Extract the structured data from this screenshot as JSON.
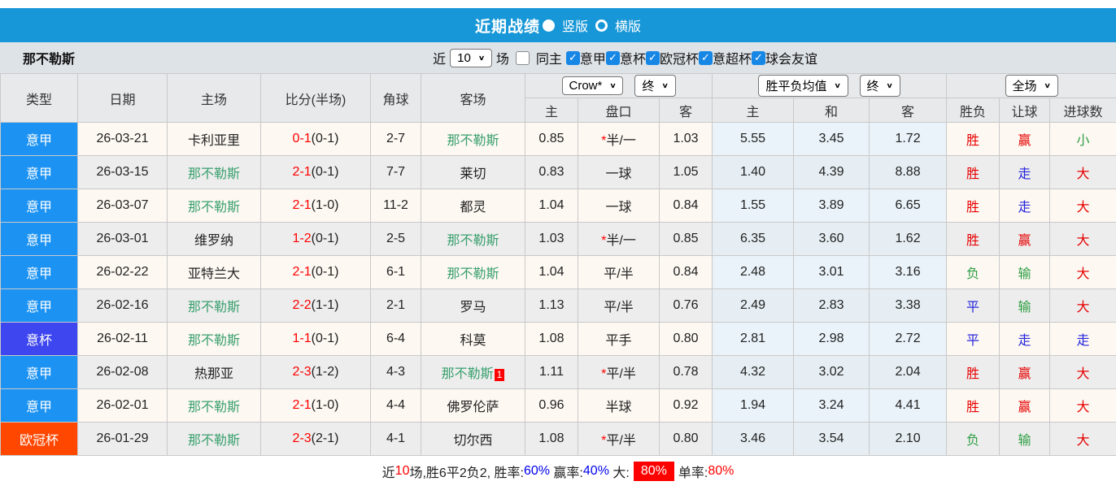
{
  "colors": {
    "accent": "#1797D7",
    "seriea": "#1C93F3",
    "coppa": "#3D46EF",
    "ucl": "#FF4700",
    "team_green": "#3AA06E",
    "red": "#E60000",
    "blue": "#2525DB",
    "green": "#2F9E44",
    "score_red": "#FF0000",
    "cb_blue": "#1787E6",
    "link_blue": "#0000EE"
  },
  "titlebar": {
    "title": "近期战绩",
    "vertical_label": "竖版",
    "horizontal_label": "横版"
  },
  "filterbar": {
    "team": "那不勒斯",
    "recent_label": "近",
    "recent_value": "10",
    "matches_label": "场",
    "same_home_label": "同主",
    "competitions": [
      "意甲",
      "意杯",
      "欧冠杯",
      "意超杯",
      "球会友谊"
    ]
  },
  "table": {
    "dropdowns": {
      "company": "Crow*",
      "company_time": "终",
      "avg": "胜平负均值",
      "avg_time": "终",
      "scope": "全场"
    },
    "headers": {
      "type": "类型",
      "date": "日期",
      "home": "主场",
      "score": "比分(半场)",
      "corners": "角球",
      "away": "客场",
      "odds_home": "主",
      "handicap": "盘口",
      "odds_away": "客",
      "avg_home": "主",
      "avg_draw": "和",
      "avg_away": "客",
      "result": "胜负",
      "let_result": "让球",
      "goal_result": "进球数"
    },
    "rows": [
      {
        "type": "意甲",
        "type_class": "seriea",
        "date": "26-03-21",
        "home": "卡利亚里",
        "home_green": false,
        "score": "0-1",
        "half": "(0-1)",
        "corners": "2-7",
        "away": "那不勒斯",
        "away_green": true,
        "away_note": "",
        "odds_home": "0.85",
        "handicap_star": true,
        "handicap": "半/一",
        "odds_away": "1.03",
        "avg_home": "5.55",
        "avg_draw": "3.45",
        "avg_away": "1.72",
        "result": "胜",
        "result_color": "red",
        "let_result": "赢",
        "let_color": "red",
        "goal_result": "小",
        "goal_color": "green"
      },
      {
        "type": "意甲",
        "type_class": "seriea",
        "date": "26-03-15",
        "home": "那不勒斯",
        "home_green": true,
        "score": "2-1",
        "half": "(0-1)",
        "corners": "7-7",
        "away": "莱切",
        "away_green": false,
        "away_note": "",
        "odds_home": "0.83",
        "handicap_star": false,
        "handicap": "一球",
        "odds_away": "1.05",
        "avg_home": "1.40",
        "avg_draw": "4.39",
        "avg_away": "8.88",
        "result": "胜",
        "result_color": "red",
        "let_result": "走",
        "let_color": "blue",
        "goal_result": "大",
        "goal_color": "red"
      },
      {
        "type": "意甲",
        "type_class": "seriea",
        "date": "26-03-07",
        "home": "那不勒斯",
        "home_green": true,
        "score": "2-1",
        "half": "(1-0)",
        "corners": "11-2",
        "away": "都灵",
        "away_green": false,
        "away_note": "",
        "odds_home": "1.04",
        "handicap_star": false,
        "handicap": "一球",
        "odds_away": "0.84",
        "avg_home": "1.55",
        "avg_draw": "3.89",
        "avg_away": "6.65",
        "result": "胜",
        "result_color": "red",
        "let_result": "走",
        "let_color": "blue",
        "goal_result": "大",
        "goal_color": "red"
      },
      {
        "type": "意甲",
        "type_class": "seriea",
        "date": "26-03-01",
        "home": "维罗纳",
        "home_green": false,
        "score": "1-2",
        "half": "(0-1)",
        "corners": "2-5",
        "away": "那不勒斯",
        "away_green": true,
        "away_note": "",
        "odds_home": "1.03",
        "handicap_star": true,
        "handicap": "半/一",
        "odds_away": "0.85",
        "avg_home": "6.35",
        "avg_draw": "3.60",
        "avg_away": "1.62",
        "result": "胜",
        "result_color": "red",
        "let_result": "赢",
        "let_color": "red",
        "goal_result": "大",
        "goal_color": "red"
      },
      {
        "type": "意甲",
        "type_class": "seriea",
        "date": "26-02-22",
        "home": "亚特兰大",
        "home_green": false,
        "score": "2-1",
        "half": "(0-1)",
        "corners": "6-1",
        "away": "那不勒斯",
        "away_green": true,
        "away_note": "",
        "odds_home": "1.04",
        "handicap_star": false,
        "handicap": "平/半",
        "odds_away": "0.84",
        "avg_home": "2.48",
        "avg_draw": "3.01",
        "avg_away": "3.16",
        "result": "负",
        "result_color": "green",
        "let_result": "输",
        "let_color": "green",
        "goal_result": "大",
        "goal_color": "red"
      },
      {
        "type": "意甲",
        "type_class": "seriea",
        "date": "26-02-16",
        "home": "那不勒斯",
        "home_green": true,
        "score": "2-2",
        "half": "(1-1)",
        "corners": "2-1",
        "away": "罗马",
        "away_green": false,
        "away_note": "",
        "odds_home": "1.13",
        "handicap_star": false,
        "handicap": "平/半",
        "odds_away": "0.76",
        "avg_home": "2.49",
        "avg_draw": "2.83",
        "avg_away": "3.38",
        "result": "平",
        "result_color": "blue",
        "let_result": "输",
        "let_color": "green",
        "goal_result": "大",
        "goal_color": "red"
      },
      {
        "type": "意杯",
        "type_class": "coppa",
        "date": "26-02-11",
        "home": "那不勒斯",
        "home_green": true,
        "score": "1-1",
        "half": "(0-1)",
        "corners": "6-4",
        "away": "科莫",
        "away_green": false,
        "away_note": "",
        "odds_home": "1.08",
        "handicap_star": false,
        "handicap": "平手",
        "odds_away": "0.80",
        "avg_home": "2.81",
        "avg_draw": "2.98",
        "avg_away": "2.72",
        "result": "平",
        "result_color": "blue",
        "let_result": "走",
        "let_color": "blue",
        "goal_result": "走",
        "goal_color": "blue"
      },
      {
        "type": "意甲",
        "type_class": "seriea",
        "date": "26-02-08",
        "home": "热那亚",
        "home_green": false,
        "score": "2-3",
        "half": "(1-2)",
        "corners": "4-3",
        "away": "那不勒斯",
        "away_green": true,
        "away_note": "1",
        "odds_home": "1.11",
        "handicap_star": true,
        "handicap": "平/半",
        "odds_away": "0.78",
        "avg_home": "4.32",
        "avg_draw": "3.02",
        "avg_away": "2.04",
        "result": "胜",
        "result_color": "red",
        "let_result": "赢",
        "let_color": "red",
        "goal_result": "大",
        "goal_color": "red"
      },
      {
        "type": "意甲",
        "type_class": "seriea",
        "date": "26-02-01",
        "home": "那不勒斯",
        "home_green": true,
        "score": "2-1",
        "half": "(1-0)",
        "corners": "4-4",
        "away": "佛罗伦萨",
        "away_green": false,
        "away_note": "",
        "odds_home": "0.96",
        "handicap_star": false,
        "handicap": "半球",
        "odds_away": "0.92",
        "avg_home": "1.94",
        "avg_draw": "3.24",
        "avg_away": "4.41",
        "result": "胜",
        "result_color": "red",
        "let_result": "赢",
        "let_color": "red",
        "goal_result": "大",
        "goal_color": "red"
      },
      {
        "type": "欧冠杯",
        "type_class": "ucl",
        "date": "26-01-29",
        "home": "那不勒斯",
        "home_green": true,
        "score": "2-3",
        "half": "(2-1)",
        "corners": "4-1",
        "away": "切尔西",
        "away_green": false,
        "away_note": "",
        "odds_home": "1.08",
        "handicap_star": true,
        "handicap": "平/半",
        "odds_away": "0.80",
        "avg_home": "3.46",
        "avg_draw": "3.54",
        "avg_away": "2.10",
        "result": "负",
        "result_color": "green",
        "let_result": "输",
        "let_color": "green",
        "goal_result": "大",
        "goal_color": "red"
      }
    ]
  },
  "footer": {
    "segments": [
      {
        "text": "近",
        "style": "plain"
      },
      {
        "text": "10",
        "style": "red"
      },
      {
        "text": "场,胜6平2负2, 胜率:",
        "style": "plain"
      },
      {
        "text": "60%",
        "style": "blue"
      },
      {
        "text": " 赢率:",
        "style": "plain"
      },
      {
        "text": "40%",
        "style": "blue"
      },
      {
        "text": " 大:",
        "style": "plain"
      },
      {
        "text": "80%",
        "style": "badge"
      },
      {
        "text": "单率:",
        "style": "plain"
      },
      {
        "text": "80%",
        "style": "red"
      }
    ]
  }
}
